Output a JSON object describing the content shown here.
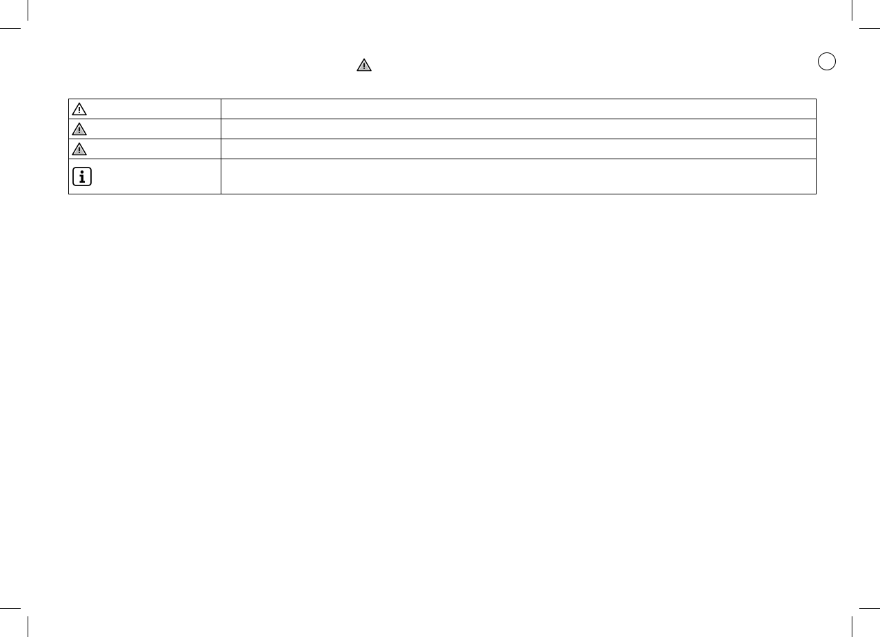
{
  "header": {
    "warning_icon": "warning-triangle-icon",
    "page_badge": ""
  },
  "symbol_table": {
    "rows": [
      {
        "icon": "warning-triangle-outline-icon",
        "description": ""
      },
      {
        "icon": "warning-triangle-shaded-icon",
        "description": ""
      },
      {
        "icon": "warning-triangle-shaded-icon",
        "description": ""
      },
      {
        "icon": "info-box-icon",
        "description": ""
      }
    ]
  },
  "colors": {
    "ink": "#000000",
    "shade": "#bdbdbd",
    "paper": "#ffffff"
  }
}
